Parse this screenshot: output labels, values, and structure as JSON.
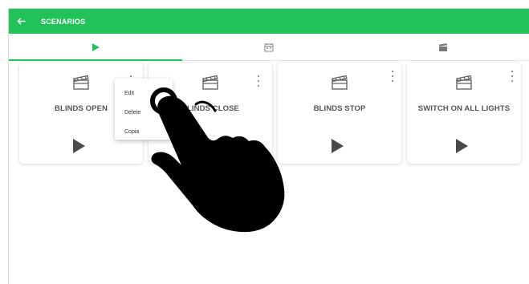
{
  "header": {
    "title": "SCENARIOS",
    "back_icon": "arrow-left-icon",
    "color": "#21c25a"
  },
  "tabs": [
    {
      "icon": "play-icon",
      "active": true
    },
    {
      "icon": "calendar-icon",
      "active": false
    },
    {
      "icon": "clapperboard-icon",
      "active": false
    }
  ],
  "cards": [
    {
      "label": "BLINDS OPEN",
      "icon": "clapperboard-icon"
    },
    {
      "label": "BLINDS CLOSE",
      "icon": "clapperboard-icon"
    },
    {
      "label": "BLINDS STOP",
      "icon": "clapperboard-icon"
    },
    {
      "label": "SWITCH ON ALL LIGHTS",
      "icon": "clapperboard-icon"
    }
  ],
  "context_menu": {
    "items": [
      "Edit",
      "Delete",
      "Copia"
    ]
  },
  "overlay": {
    "icon": "tap-hand-icon"
  }
}
